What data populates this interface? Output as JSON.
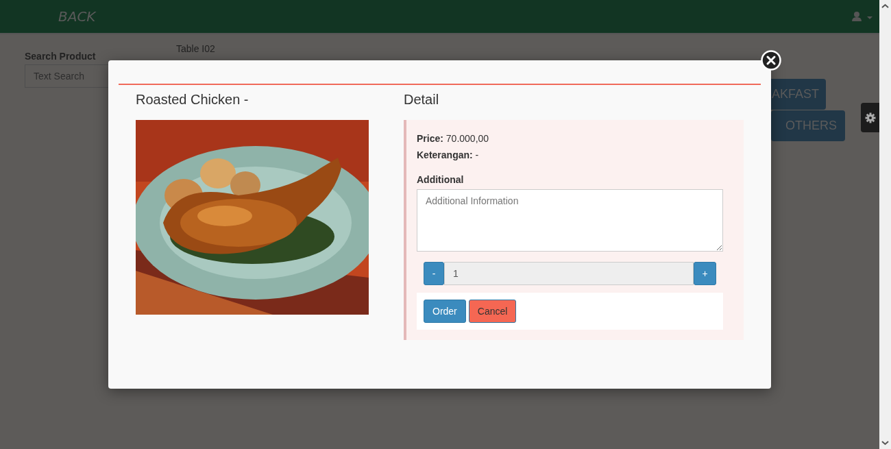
{
  "navbar": {
    "back_label": "BACK"
  },
  "search": {
    "label": "Search Product",
    "placeholder": "Text Search"
  },
  "table_label": "Table I02",
  "categories": [
    {
      "label": "AKFAST"
    },
    {
      "label": "OTHERS"
    }
  ],
  "modal": {
    "title": "Roasted Chicken -",
    "detail_heading": "Detail",
    "price": "**Price:** 70.000,00",
    "note": "**Keterangan:** -",
    "additional_label": "Additional",
    "additional_placeholder": "Additional Information",
    "quantity": "1",
    "minus": "-",
    "plus": "+",
    "buttons": [
      {
        "label": "Order",
        "kind": "primary"
      },
      {
        "label": "Cancel",
        "kind": "danger"
      }
    ]
  }
}
